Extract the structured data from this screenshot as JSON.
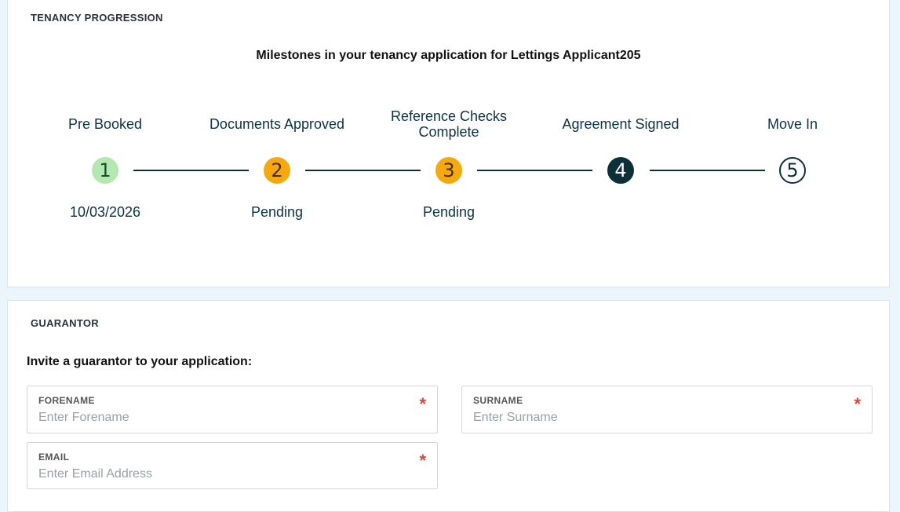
{
  "progress": {
    "title": "TENANCY PROGRESSION",
    "subtitle": "Milestones in your tenancy application for Lettings Applicant205",
    "steps": [
      {
        "label": "Pre Booked",
        "number": "1",
        "status": "10/03/2026",
        "state": "complete"
      },
      {
        "label": "Documents Approved",
        "number": "2",
        "status": "Pending",
        "state": "pending"
      },
      {
        "label": "Reference Checks Complete",
        "number": "3",
        "status": "Pending",
        "state": "pending"
      },
      {
        "label": "Agreement Signed",
        "number": "4",
        "status": "",
        "state": "current"
      },
      {
        "label": "Move In",
        "number": "5",
        "status": "",
        "state": "upcoming"
      }
    ]
  },
  "guarantor": {
    "title": "GUARANTOR",
    "invite": "Invite a guarantor to your application:",
    "forename": {
      "label": "FORENAME",
      "placeholder": "Enter Forename",
      "value": ""
    },
    "surname": {
      "label": "SURNAME",
      "placeholder": "Enter Surname",
      "value": ""
    },
    "email": {
      "label": "EMAIL",
      "placeholder": "Enter Email Address",
      "value": ""
    },
    "required_mark": "*"
  },
  "colors": {
    "complete": "#b3e8b0",
    "pending": "#f5a90f",
    "current": "#0d2f3a",
    "required": "#e0453a"
  }
}
